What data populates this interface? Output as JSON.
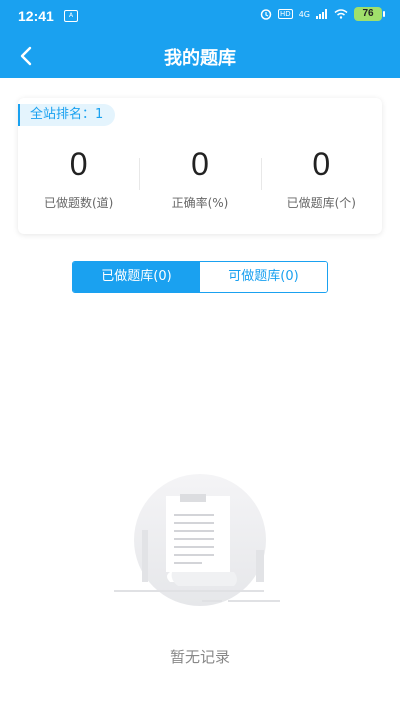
{
  "status_bar": {
    "time": "12:41",
    "notif": "A",
    "badge": "HD",
    "network": "4G",
    "battery": "76"
  },
  "nav": {
    "title": "我的题库"
  },
  "rank": {
    "text": "全站排名：1"
  },
  "stats": [
    {
      "value": "0",
      "label": "已做题数(道)"
    },
    {
      "value": "0",
      "label": "正确率(%)"
    },
    {
      "value": "0",
      "label": "已做题库(个)"
    }
  ],
  "tabs": [
    {
      "label": "已做题库(0)"
    },
    {
      "label": "可做题库(0)"
    }
  ],
  "empty": {
    "text": "暂无记录"
  },
  "colors": {
    "primary": "#1aa1f0",
    "background": "#ffffff"
  }
}
